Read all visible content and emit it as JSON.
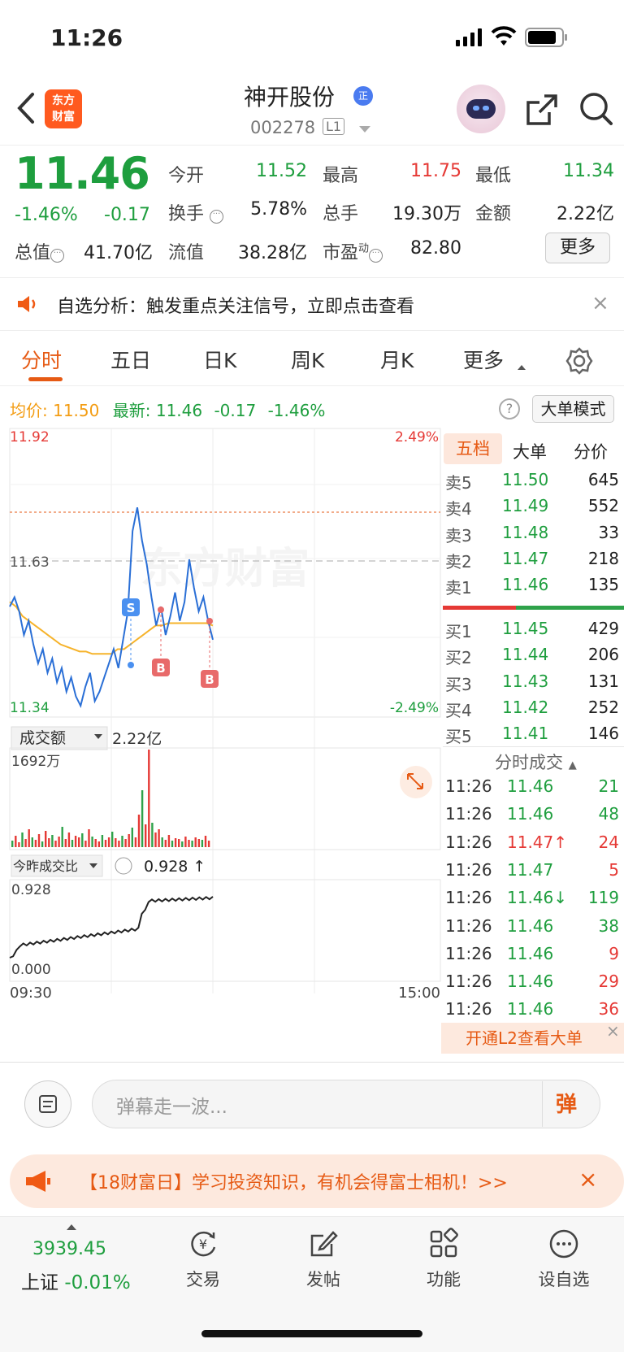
{
  "status_bar": {
    "time": "11:26"
  },
  "header": {
    "logo_line1": "东方",
    "logo_line2": "财富",
    "stock_name": "神开股份",
    "name_badge": "正",
    "stock_code": "002278",
    "level_badge": "L1"
  },
  "quote": {
    "price": "11.46",
    "change_pct": "-1.46%",
    "change": "-0.17",
    "open_label": "今开",
    "open": "11.52",
    "high_label": "最高",
    "high": "11.75",
    "low_label": "最低",
    "low": "11.34",
    "turnover_label": "换手",
    "turnover": "5.78%",
    "volume_label": "总手",
    "volume": "19.30万",
    "amount_label": "金额",
    "amount": "2.22亿",
    "mktcap_label": "总值",
    "mktcap": "41.70亿",
    "float_label": "流值",
    "float": "38.28亿",
    "pe_label": "市盈",
    "pe_sup": "动",
    "pe": "82.80",
    "more_label": "更多"
  },
  "banner": {
    "text": "自选分析：触发重点关注信号，立即点击查看"
  },
  "tabs": [
    {
      "label": "分时"
    },
    {
      "label": "五日"
    },
    {
      "label": "日K"
    },
    {
      "label": "周K"
    },
    {
      "label": "月K"
    },
    {
      "label": "更多"
    }
  ],
  "avg_row": {
    "avg_label": "均价:",
    "avg": "11.50",
    "latest_label": "最新:",
    "latest": "11.46",
    "chg": "-0.17",
    "chg_pct": "-1.46%",
    "big_order_label": "大单模式"
  },
  "chart_labels": {
    "y_max": "11.92",
    "y_mid": "11.63",
    "y_min": "11.34",
    "pct_max": "2.49%",
    "pct_min": "-2.49%",
    "watermark": "东方财富",
    "vol_selector": "成交额",
    "vol_total": "2.22亿",
    "vol_max": "1692万",
    "ratio_selector": "今昨成交比",
    "ratio_value": "0.928 ↑",
    "ratio_top": "0.928",
    "ratio_bottom": "0.000",
    "time_start": "09:30",
    "time_end": "15:00",
    "marker_s": "S",
    "marker_b": "B"
  },
  "chart_data": {
    "type": "line",
    "title": "",
    "xlabel": "",
    "ylabel": "",
    "ylim": [
      11.34,
      11.92
    ],
    "series": [
      {
        "values": [
          11.56,
          11.58,
          11.55,
          11.5,
          11.53,
          11.48,
          11.44,
          11.47,
          11.42,
          11.45,
          11.4,
          11.43,
          11.38,
          11.41,
          11.37,
          11.35,
          11.39,
          11.42,
          11.36,
          11.38,
          11.41,
          11.44,
          11.47,
          11.43,
          11.49,
          11.55,
          11.72,
          11.77,
          11.7,
          11.65,
          11.58,
          11.52,
          11.56,
          11.5,
          11.54,
          11.59,
          11.53,
          11.57,
          11.66,
          11.6,
          11.55,
          11.58,
          11.53,
          11.49
        ]
      },
      {
        "values": [
          11.57,
          11.56,
          11.54,
          11.53,
          11.52,
          11.51,
          11.5,
          11.49,
          11.48,
          11.475,
          11.47,
          11.465,
          11.465,
          11.46,
          11.46,
          11.46,
          11.46,
          11.47,
          11.47,
          11.48,
          11.49,
          11.5,
          11.51,
          11.52,
          11.52,
          11.525,
          11.525,
          11.525,
          11.525,
          11.525,
          11.525,
          11.525,
          11.52
        ]
      }
    ],
    "annotations": [
      "S",
      "B",
      "B"
    ]
  },
  "order_book": {
    "tabs": [
      "五档",
      "大单",
      "分价"
    ],
    "asks": [
      {
        "label": "卖5",
        "price": "11.50",
        "vol": "645"
      },
      {
        "label": "卖4",
        "price": "11.49",
        "vol": "552"
      },
      {
        "label": "卖3",
        "price": "11.48",
        "vol": "33"
      },
      {
        "label": "卖2",
        "price": "11.47",
        "vol": "218"
      },
      {
        "label": "卖1",
        "price": "11.46",
        "vol": "135"
      }
    ],
    "bids": [
      {
        "label": "买1",
        "price": "11.45",
        "vol": "429"
      },
      {
        "label": "买2",
        "price": "11.44",
        "vol": "206"
      },
      {
        "label": "买3",
        "price": "11.43",
        "vol": "131"
      },
      {
        "label": "买4",
        "price": "11.42",
        "vol": "252"
      },
      {
        "label": "买5",
        "price": "11.41",
        "vol": "146"
      }
    ],
    "trades_title": "分时成交",
    "trades": [
      {
        "time": "11:26",
        "price": "11.46",
        "vol": "21"
      },
      {
        "time": "11:26",
        "price": "11.46",
        "vol": "48"
      },
      {
        "time": "11:26",
        "price": "11.47↑",
        "vol": "24"
      },
      {
        "time": "11:26",
        "price": "11.47",
        "vol": "5"
      },
      {
        "time": "11:26",
        "price": "11.46↓",
        "vol": "119"
      },
      {
        "time": "11:26",
        "price": "11.46",
        "vol": "38"
      },
      {
        "time": "11:26",
        "price": "11.46",
        "vol": "9"
      },
      {
        "time": "11:26",
        "price": "11.46",
        "vol": "29"
      },
      {
        "time": "11:26",
        "price": "11.46",
        "vol": "36"
      }
    ],
    "l2_label": "开通L2查看大单"
  },
  "comment": {
    "placeholder": "弹幕走一波...",
    "danmu": "弹"
  },
  "promo": {
    "text": "【18财富日】学习投资知识，有机会得富士相机！>>"
  },
  "bottom_nav": {
    "index_value": "3939.45",
    "index_name": "上证",
    "index_change": "-0.01%",
    "items": [
      {
        "label": "交易"
      },
      {
        "label": "发帖"
      },
      {
        "label": "功能"
      },
      {
        "label": "设自选"
      }
    ]
  }
}
